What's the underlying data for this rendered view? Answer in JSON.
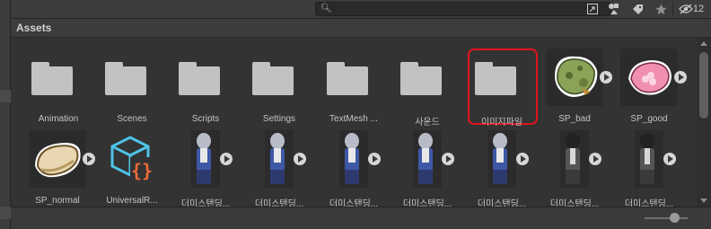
{
  "toolbar": {
    "search_value": "",
    "hidden_count": "12"
  },
  "panel": {
    "title": "Assets"
  },
  "assets": [
    {
      "label": "Animation",
      "type": "folder"
    },
    {
      "label": "Scenes",
      "type": "folder"
    },
    {
      "label": "Scripts",
      "type": "folder"
    },
    {
      "label": "Settings",
      "type": "folder"
    },
    {
      "label": "TextMesh ...",
      "type": "folder"
    },
    {
      "label": "사운드",
      "type": "folder"
    },
    {
      "label": "이미지파일",
      "type": "folder",
      "selected": true
    },
    {
      "label": "SP_bad",
      "type": "sprite"
    },
    {
      "label": "SP_good",
      "type": "sprite"
    },
    {
      "label": "SP_normal",
      "type": "sprite"
    },
    {
      "label": "UniversalR...",
      "type": "asset"
    },
    {
      "label": "더미스탠딩...",
      "type": "sprite"
    },
    {
      "label": "더미스탠딩...",
      "type": "sprite"
    },
    {
      "label": "더미스탠딩...",
      "type": "sprite"
    },
    {
      "label": "더미스탠딩...",
      "type": "sprite"
    },
    {
      "label": "더미스탠딩...",
      "type": "sprite"
    },
    {
      "label": "더미스탠딩...",
      "type": "sprite"
    },
    {
      "label": "더미스탠딩...",
      "type": "sprite"
    }
  ],
  "colors": {
    "selection_outline": "#e0141e",
    "folder": "#c2c2c2",
    "panel_bg": "#333333"
  },
  "zoom_slider": {
    "value_fraction": 0.6
  }
}
